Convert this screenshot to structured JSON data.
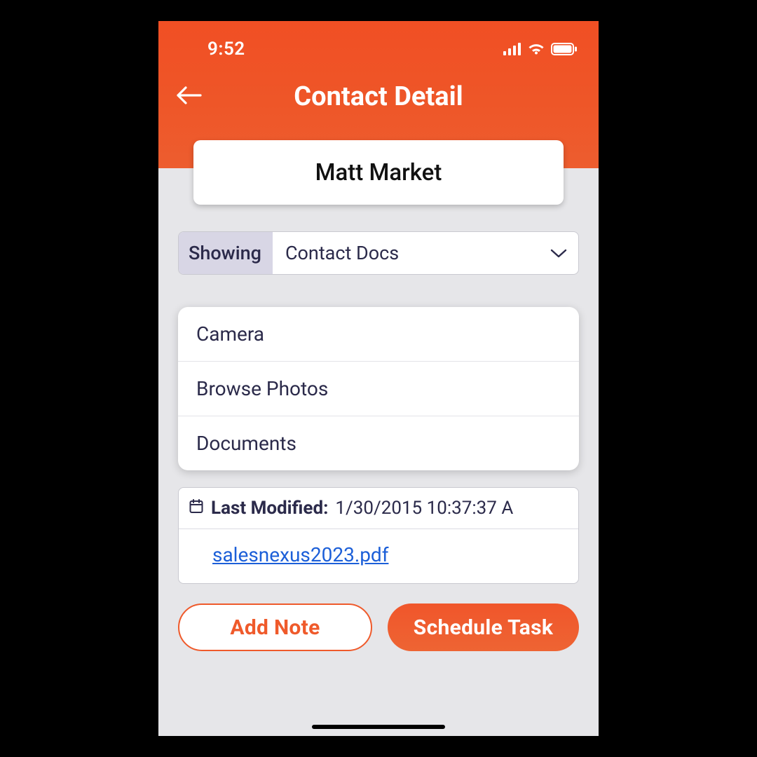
{
  "status": {
    "time": "9:52"
  },
  "header": {
    "title": "Contact Detail"
  },
  "contact": {
    "name": "Matt Market"
  },
  "filter": {
    "label": "Showing",
    "value": "Contact Docs"
  },
  "menu": {
    "items": [
      {
        "label": "Camera"
      },
      {
        "label": "Browse Photos"
      },
      {
        "label": "Documents"
      }
    ]
  },
  "document": {
    "modified_label": "Last Modified:",
    "modified_value": "1/30/2015 10:37:37 A",
    "filename": "salesnexus2023.pdf"
  },
  "actions": {
    "add_note": "Add Note",
    "schedule_task": "Schedule Task"
  }
}
